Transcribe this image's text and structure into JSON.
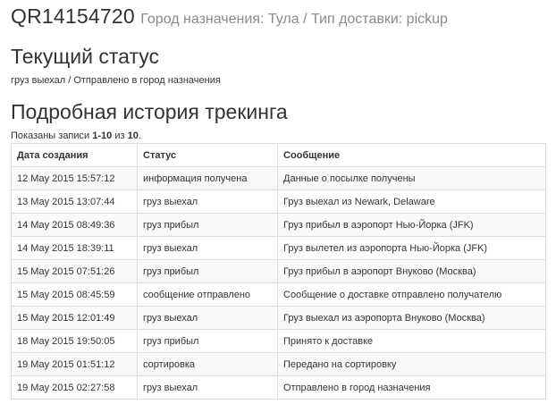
{
  "header": {
    "tracking_number": "QR14154720",
    "subtitle": "Город назначения: Тула / Тип доставки: pickup"
  },
  "current_status": {
    "heading": "Текущий статус",
    "text": "груз выехал / Отправлено в город назначения"
  },
  "history": {
    "heading": "Подробная история трекинга",
    "records_prefix": "Показаны записи ",
    "records_range": "1-10",
    "records_of": " из ",
    "records_total": "10",
    "records_suffix": ".",
    "columns": [
      "Дата создания",
      "Статус",
      "Сообщение"
    ],
    "rows": [
      [
        "12 May 2015 15:57:12",
        "информация получена",
        "Данные о посылке получены"
      ],
      [
        "13 May 2015 13:07:44",
        "груз выехал",
        "Груз выехал из Newark, Delaware"
      ],
      [
        "14 May 2015 08:49:36",
        "груз прибыл",
        "Груз прибыл в аэропорт Нью-Йорка (JFK)"
      ],
      [
        "14 May 2015 18:39:11",
        "груз выехал",
        "Груз вылетел из аэропорта Нью-Йорка (JFK)"
      ],
      [
        "15 May 2015 07:51:26",
        "груз прибыл",
        "Груз прибыл в аэропорт Внуково (Москва)"
      ],
      [
        "15 May 2015 08:45:59",
        "сообщение отправлено",
        "Сообщение о доставке отправлено получателю"
      ],
      [
        "15 May 2015 12:01:49",
        "груз выехал",
        "Груз выехал из аэропорта Внуково (Москва)"
      ],
      [
        "18 May 2015 19:50:05",
        "груз прибыл",
        "Принято к доставке"
      ],
      [
        "19 May 2015 01:51:12",
        "сортировка",
        "Передано на сортировку"
      ],
      [
        "19 May 2015 02:27:58",
        "груз выехал",
        "Отправлено в город назначения"
      ]
    ]
  }
}
